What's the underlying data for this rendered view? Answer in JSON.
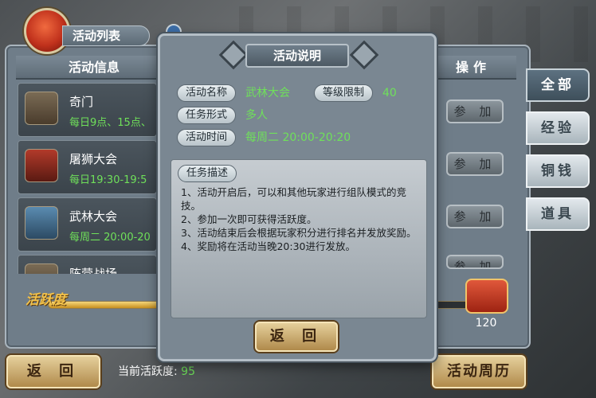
{
  "panel": {
    "title": "活动列表",
    "col_info": "活动信息",
    "col_op": "操作"
  },
  "activities": [
    {
      "name": "奇门",
      "time": "每日9点、15点、",
      "join": "参 加"
    },
    {
      "name": "屠狮大会",
      "time": "每日19:30-19:5",
      "join": "参 加"
    },
    {
      "name": "武林大会",
      "time": "每周二 20:00-20",
      "join": "参 加"
    },
    {
      "name": "阵营战场",
      "time": "",
      "join": "参 加"
    }
  ],
  "tabs": [
    "全部",
    "经验",
    "铜钱",
    "道具"
  ],
  "active_tab": 0,
  "activity_bar": {
    "label": "活跃度",
    "reward": "120",
    "progress": 0.79
  },
  "bottom": {
    "back": "返 回",
    "current_label": "当前活跃度:",
    "current_value": "95",
    "calendar": "活动周历"
  },
  "modal": {
    "title": "活动说明",
    "name_label": "活动名称",
    "name_value": "武林大会",
    "level_label": "等级限制",
    "level_value": "40",
    "form_label": "任务形式",
    "form_value": "多人",
    "time_label": "活动时间",
    "time_value": "每周二 20:00-20:20",
    "desc_label": "任务描述",
    "desc_lines": [
      "1、活动开启后，可以和其他玩家进行组队模式的竞技。",
      "2、参加一次即可获得活跃度。",
      "3、活动结束后会根据玩家积分进行排名并发放奖励。",
      "4、奖励将在活动当晚20:30进行发放。"
    ],
    "back": "返 回"
  },
  "colors": {
    "accent_green": "#6fe05a",
    "gold": "#f3c24b"
  }
}
